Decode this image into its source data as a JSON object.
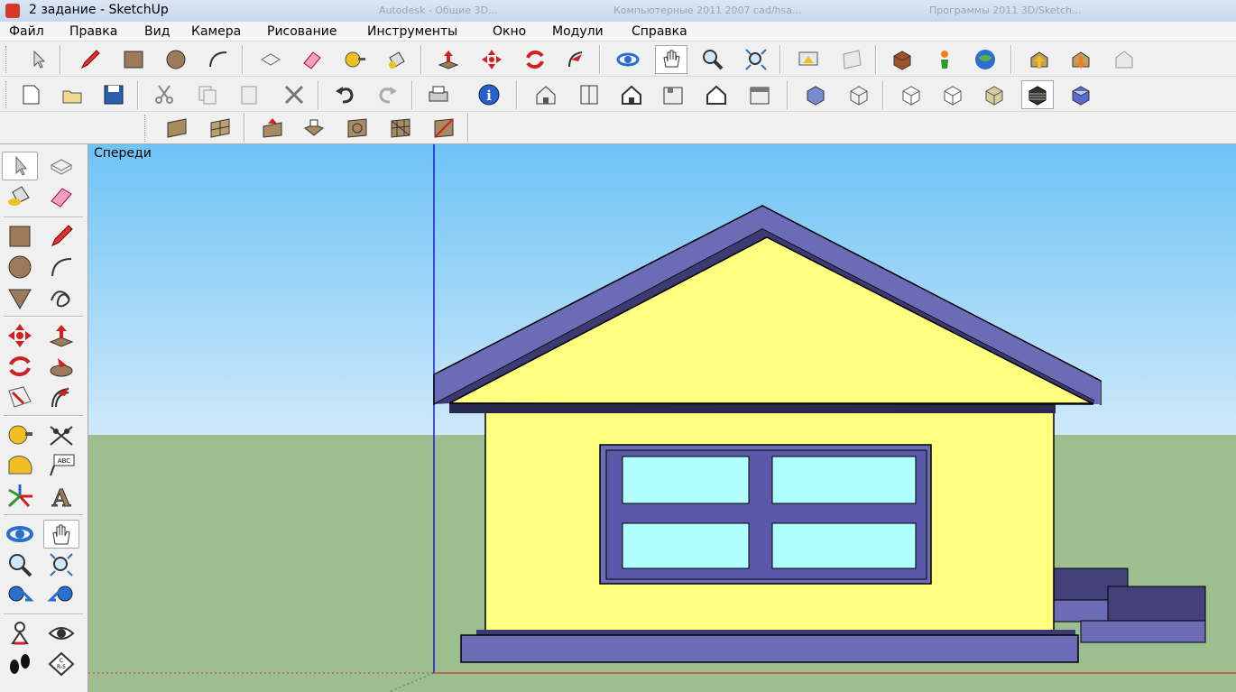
{
  "window": {
    "title": "2 задание - SketchUp",
    "ghost_tabs": [
      "Autodesk - Общие 3D...",
      "Компьютерные 2011 2007 cad/hsa...",
      "Программы 2011 3D/Sketch..."
    ]
  },
  "menu": {
    "file": "Файл",
    "edit": "Правка",
    "view": "Вид",
    "camera": "Камера",
    "draw": "Рисование",
    "tools": "Инструменты",
    "window": "Окно",
    "plugins": "Модули",
    "help": "Справка"
  },
  "viewport": {
    "scene_label": "Спереди"
  },
  "colors": {
    "sky_top": "#6ec3f5",
    "sky_bottom": "#cfe9fb",
    "ground": "#9dbe8f",
    "wall": "#ffff80",
    "roof": "#6b6bb6",
    "glass": "#b0ffff",
    "edge": "#000000",
    "blue_axis": "#1c1cd8",
    "red_axis": "#d43030",
    "green_axis": "#2a9a2a"
  },
  "icons": {
    "toolbar_row1": [
      "select-icon",
      "pencil-icon",
      "rectangle-icon",
      "circle-icon",
      "arc-icon",
      "erase-icon",
      "eraser-icon",
      "tape-measure-icon",
      "paint-bucket-icon",
      "push-pull-icon",
      "move-icon",
      "rotate-icon",
      "follow-me-icon",
      "orbit-icon",
      "pan-icon",
      "zoom-icon",
      "zoom-extents-icon",
      "get-models-icon",
      "share-model-icon",
      "component-icon",
      "location-icon",
      "google-earth-icon",
      "export-icon",
      "import-icon",
      "preview-icon"
    ],
    "toolbar_row2": [
      "new-icon",
      "open-icon",
      "save-icon",
      "cut-icon",
      "copy-icon",
      "paste-icon",
      "delete-icon",
      "undo-icon",
      "redo-icon",
      "print-icon",
      "model-info-icon",
      "iso-view-icon",
      "top-view-icon",
      "front-view-icon",
      "right-view-icon",
      "back-view-icon",
      "left-view-icon",
      "xray-icon",
      "wireframe-icon",
      "hidden-line-icon",
      "shaded-icon",
      "shaded-texture-icon",
      "monochrome-icon",
      "xray-style-icon"
    ],
    "toolbar_row3": [
      "sandbox-from-contours-icon",
      "sandbox-from-scratch-icon",
      "smoove-icon",
      "stamp-icon",
      "drape-icon",
      "add-detail-icon",
      "flip-edge-icon"
    ]
  }
}
